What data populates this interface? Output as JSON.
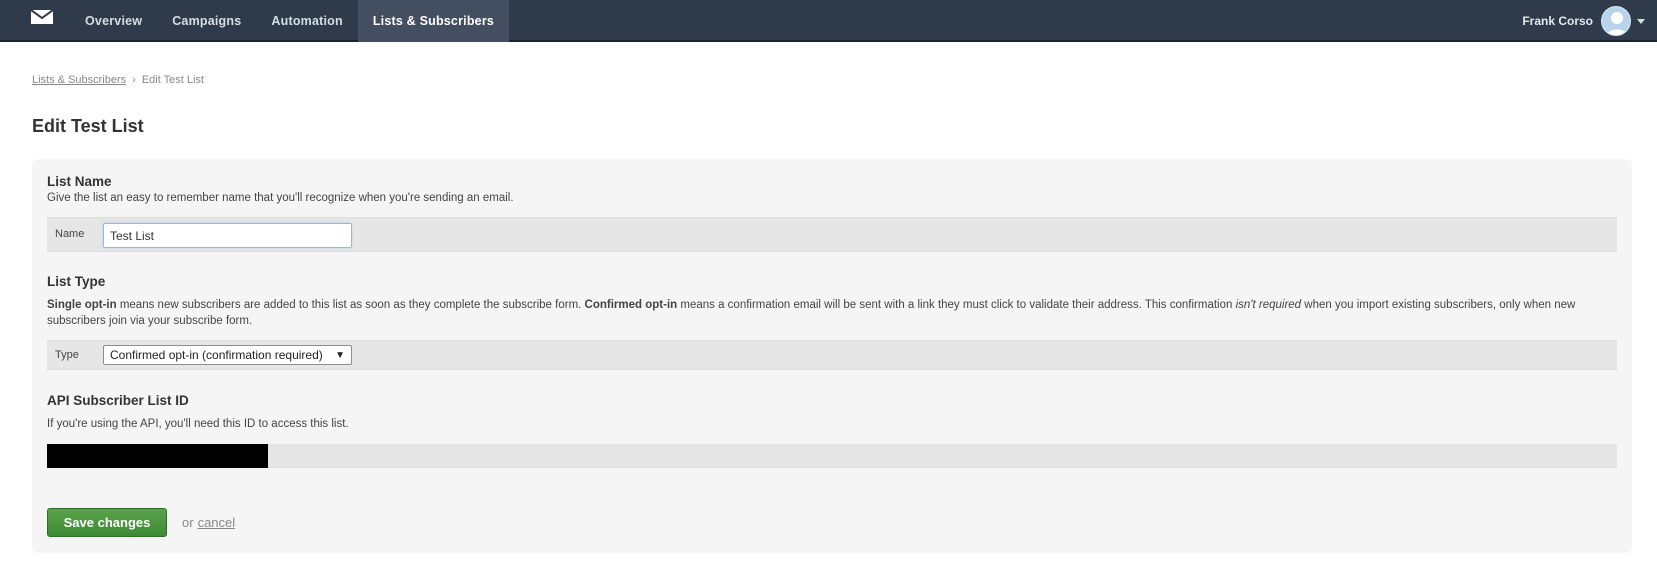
{
  "nav": {
    "logo_icon": "envelope-icon",
    "items": [
      {
        "label": "Overview",
        "active": false
      },
      {
        "label": "Campaigns",
        "active": false
      },
      {
        "label": "Automation",
        "active": false
      },
      {
        "label": "Lists & Subscribers",
        "active": true
      }
    ],
    "user_name": "Frank Corso",
    "avatar_icon": "user-avatar-icon",
    "dropdown_icon": "caret-down-icon"
  },
  "breadcrumb": {
    "parent": "Lists & Subscribers",
    "separator": "›",
    "current": "Edit Test List"
  },
  "page": {
    "title": "Edit Test List"
  },
  "list_name": {
    "title": "List Name",
    "description": "Give the list an easy to remember name that you'll recognize when you're sending an email.",
    "field_label": "Name",
    "value": "Test List"
  },
  "list_type": {
    "title": "List Type",
    "desc_single_bold": "Single opt-in",
    "desc_single_rest": " means new subscribers are added to this list as soon as they complete the subscribe form. ",
    "desc_confirmed_bold": "Confirmed opt-in",
    "desc_confirmed_rest": " means a confirmation email will be sent with a link they must click to validate their address. This confirmation ",
    "desc_italic": "isn't required",
    "desc_end": " when you import existing subscribers, only when new subscribers join via your subscribe form.",
    "field_label": "Type",
    "selected": "Confirmed opt-in (confirmation required)",
    "arrow": "▼"
  },
  "api": {
    "title": "API Subscriber List ID",
    "description": "If you're using the API, you'll need this ID to access this list."
  },
  "actions": {
    "save_label": "Save changes",
    "or_text": "or",
    "cancel_label": "cancel"
  },
  "colors": {
    "topbar": "#2f3a4a",
    "active_tab": "#434f60",
    "save_button": "#4a9740",
    "panel": "#f5f5f5"
  }
}
